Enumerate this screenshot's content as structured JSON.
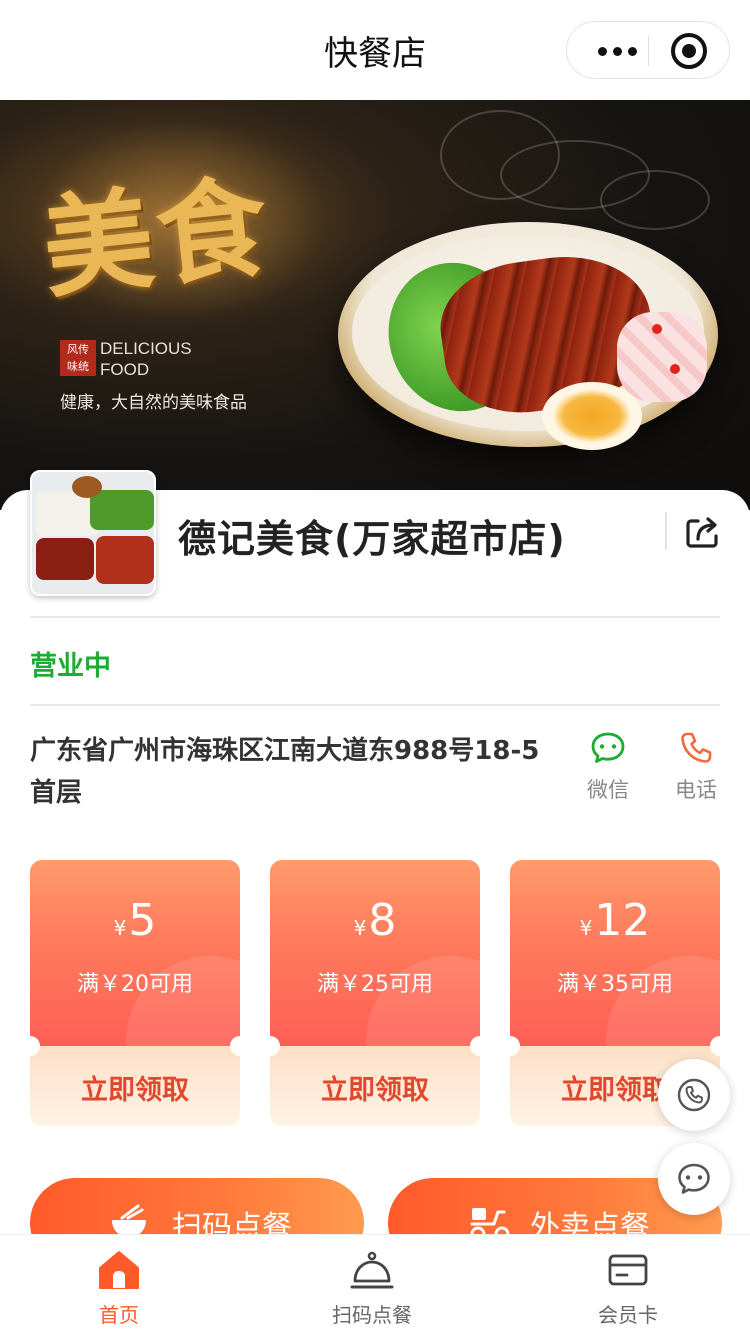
{
  "nav": {
    "title": "快餐店",
    "more_icon": "more-dots-icon",
    "close_icon": "target-close-icon"
  },
  "banner": {
    "title": "美食",
    "seal": "风传 味统",
    "en_line1": "DELICIOUS",
    "en_line2": "FOOD",
    "subtitle": "健康，大自然的美味食品"
  },
  "store": {
    "name": "德记美食(万家超市店)",
    "status": "营业中",
    "status_color": "#1dab31",
    "address": "广东省广州市海珠区江南大道东988号18-5首层",
    "share_icon": "share-icon",
    "contacts": [
      {
        "label": "微信",
        "icon": "wechat-icon",
        "color": "#1dab31"
      },
      {
        "label": "电话",
        "icon": "phone-icon",
        "color": "#f26a3b"
      }
    ]
  },
  "coupons": [
    {
      "currency": "¥",
      "amount": "5",
      "condition": "满￥20可用",
      "action": "立即领取"
    },
    {
      "currency": "¥",
      "amount": "8",
      "condition": "满￥25可用",
      "action": "立即领取"
    },
    {
      "currency": "¥",
      "amount": "12",
      "condition": "满￥35可用",
      "action": "立即领取"
    }
  ],
  "floating": [
    {
      "icon": "phone-icon"
    },
    {
      "icon": "chat-bubble-icon"
    }
  ],
  "order_buttons": [
    {
      "label": "扫码点餐",
      "icon": "bowl-icon"
    },
    {
      "label": "外卖点餐",
      "icon": "scooter-icon"
    }
  ],
  "tabbar": {
    "accent": "#ff5a2a",
    "items": [
      {
        "label": "首页",
        "icon": "home-icon",
        "active": true
      },
      {
        "label": "扫码点餐",
        "icon": "cloche-icon",
        "active": false
      },
      {
        "label": "会员卡",
        "icon": "card-icon",
        "active": false
      }
    ]
  }
}
